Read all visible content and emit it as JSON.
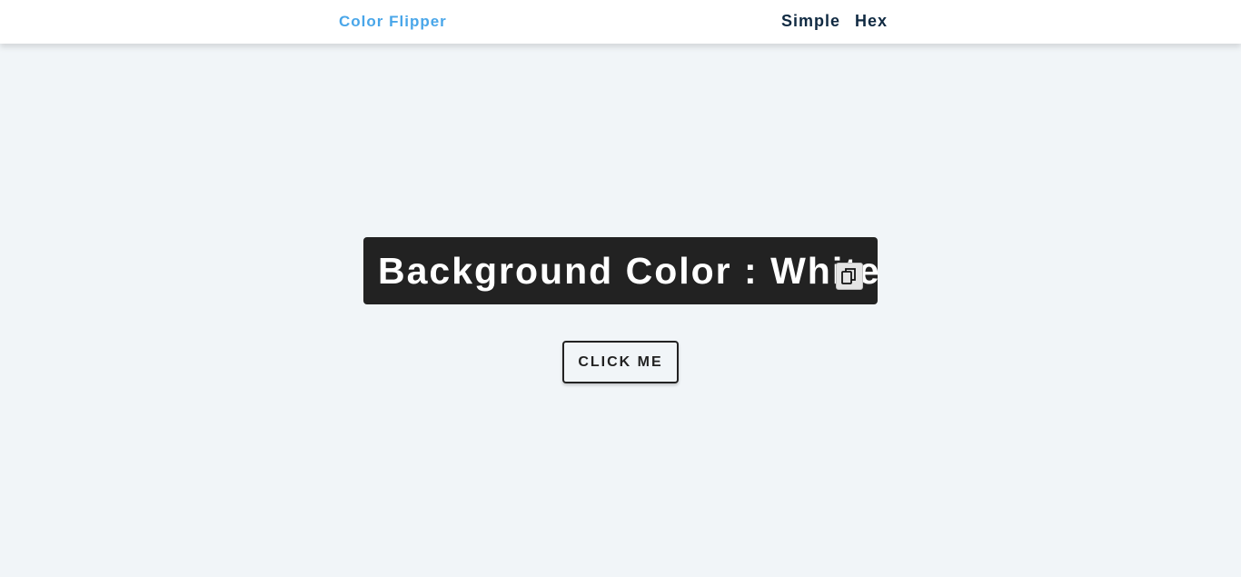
{
  "nav": {
    "brand": "Color Flipper",
    "links": [
      {
        "label": "Simple"
      },
      {
        "label": "Hex"
      }
    ]
  },
  "main": {
    "color_label": "Background Color : ",
    "color_value": "White",
    "copy_icon": "copy-icon",
    "button_label": "CLICK ME"
  },
  "colors": {
    "brand": "#49a6e9",
    "nav_text": "#102a42",
    "background": "#f1f5f8",
    "title_box": "#222222",
    "title_text": "#ffffff"
  }
}
